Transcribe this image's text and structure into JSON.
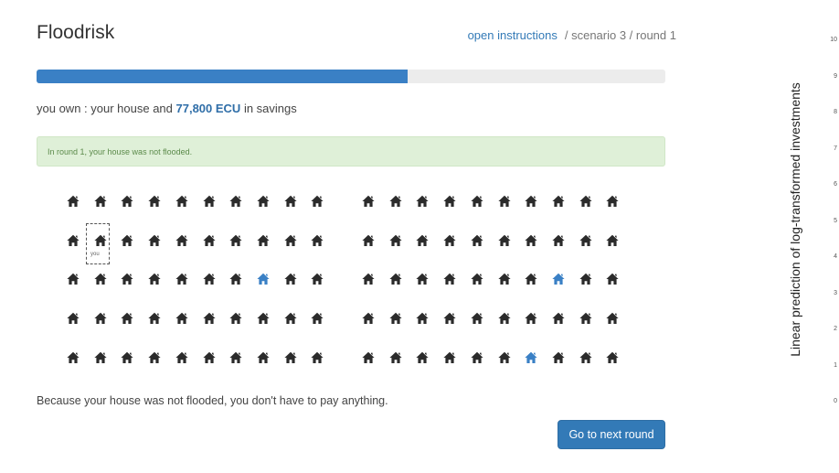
{
  "app": {
    "title": "Floodrisk",
    "instructions_link": "open instructions",
    "scenario_round": "/ scenario 3 / round 1"
  },
  "progress": {
    "fraction": 0.59
  },
  "status": {
    "prefix": "you own : your house and ",
    "amount": "77,800 ECU",
    "suffix": " in savings"
  },
  "alert": {
    "text": "In round 1, your house was not flooded."
  },
  "grid": {
    "rows": 5,
    "cols": 10,
    "highlighted": [
      {
        "block": 0,
        "row": 2,
        "col": 7
      },
      {
        "block": 1,
        "row": 2,
        "col": 7
      },
      {
        "block": 1,
        "row": 4,
        "col": 6
      }
    ],
    "own_house": {
      "block": 0,
      "row": 1,
      "col": 1
    },
    "own_house_label": "you",
    "house_color": "#2b2b2b",
    "highlight_color": "#3a80c5"
  },
  "message": "Because your house was not flooded, you don't have to pay anything.",
  "next_button": "Go to next round",
  "side_panel": {
    "ylabel": "Linear prediction of log-transformed investments",
    "ticks": [
      "10",
      "9",
      "8",
      "7",
      "6",
      "5",
      "4",
      "3",
      "2",
      "1",
      "0"
    ]
  }
}
